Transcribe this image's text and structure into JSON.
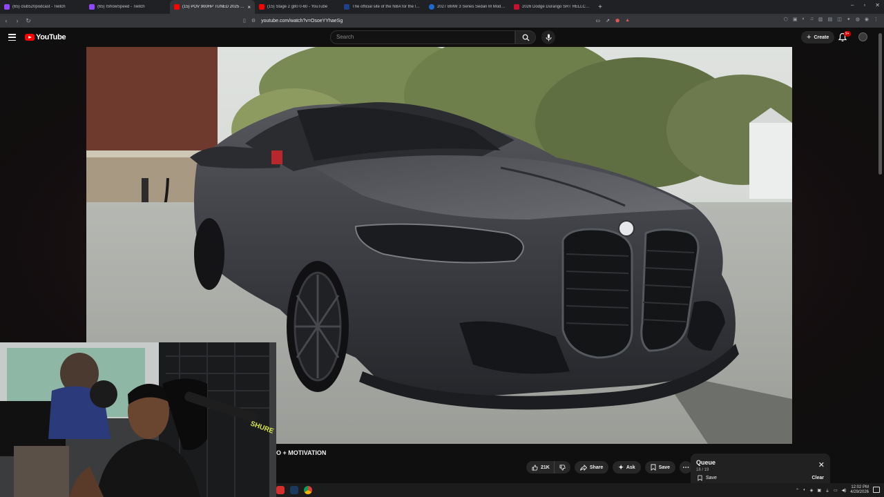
{
  "browser": {
    "tabs": [
      {
        "title": "(65) club520podcast - Twitch",
        "favicon_color": "#9146ff",
        "active": false
      },
      {
        "title": "(65) IShowSpeed - Twitch",
        "favicon_color": "#9146ff",
        "active": false
      },
      {
        "title": "(15) POV 900HP TUNED 2025 BMW",
        "favicon_color": "#ff0000",
        "active": true
      },
      {
        "title": "(15) Stage 2 g80 0-60 - YouTube",
        "favicon_color": "#ff0000",
        "active": false
      },
      {
        "title": "The official site of the NBA for the latest",
        "favicon_color": "#1d428a",
        "active": false
      },
      {
        "title": "2027 BMW 3 Series Sedan M Models",
        "favicon_color": "#1c69d4",
        "active": false
      },
      {
        "title": "2026 Dodge Durango SRT HELLCAT",
        "favicon_color": "#c8102e",
        "active": false
      }
    ],
    "url": "youtube.com/watch?v=OsoeYYhaeSg"
  },
  "youtube": {
    "logo_text": "YouTube",
    "search_placeholder": "Search",
    "create_label": "Create",
    "notification_count": "9+"
  },
  "video": {
    "title_visible": "O + MOTIVATION",
    "actions": {
      "like_count": "21K",
      "share_label": "Share",
      "ask_label": "Ask",
      "save_label": "Save"
    }
  },
  "queue": {
    "title": "Queue",
    "position": "18 / 19",
    "save_label": "Save",
    "clear_label": "Clear"
  },
  "taskbar": {
    "time": "12:02 PM",
    "date": "4/29/2026"
  },
  "colors": {
    "brand_red": "#ff0000",
    "background": "#0f0f0f",
    "pill_bg": "#272727"
  }
}
